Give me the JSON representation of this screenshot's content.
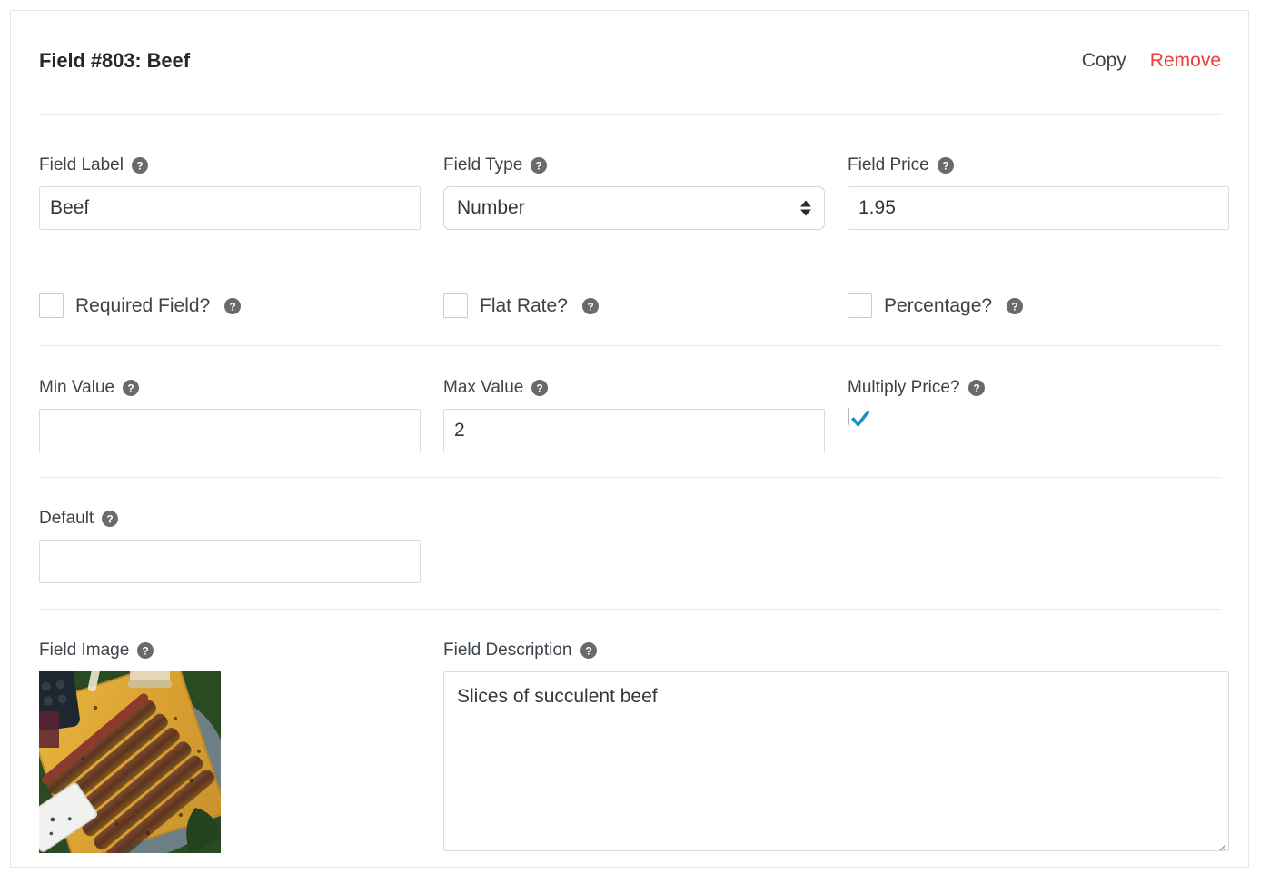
{
  "card": {
    "title": "Field #803: Beef",
    "actions": {
      "copy_label": "Copy",
      "remove_label": "Remove"
    }
  },
  "colors": {
    "accent_checkbox": "#1e8cbe",
    "danger": "#e8403a",
    "text": "#3c434a",
    "border": "#dcdcdc",
    "divider": "#e9e9e9"
  },
  "fields": {
    "field_label": {
      "label": "Field Label",
      "help": "?",
      "value": "Beef",
      "placeholder": ""
    },
    "field_type": {
      "label": "Field Type",
      "help": "?",
      "value": "Number"
    },
    "field_price": {
      "label": "Field Price",
      "help": "?",
      "value": "1.95",
      "placeholder": ""
    },
    "required_field": {
      "label": "Required Field?",
      "help": "?",
      "checked": false
    },
    "flat_rate": {
      "label": "Flat Rate?",
      "help": "?",
      "checked": false
    },
    "percentage": {
      "label": "Percentage?",
      "help": "?",
      "checked": false
    },
    "min_value": {
      "label": "Min Value",
      "help": "?",
      "value": "",
      "placeholder": ""
    },
    "max_value": {
      "label": "Max Value",
      "help": "?",
      "value": "2",
      "placeholder": ""
    },
    "multiply_price": {
      "label": "Multiply Price?",
      "help": "?",
      "checked": true
    },
    "default": {
      "label": "Default",
      "help": "?",
      "value": "",
      "placeholder": ""
    },
    "field_image": {
      "label": "Field Image",
      "help": "?",
      "alt": "sliced beef on a wooden cutting board"
    },
    "field_description": {
      "label": "Field Description",
      "help": "?",
      "value": "Slices of succulent beef",
      "placeholder": ""
    }
  }
}
